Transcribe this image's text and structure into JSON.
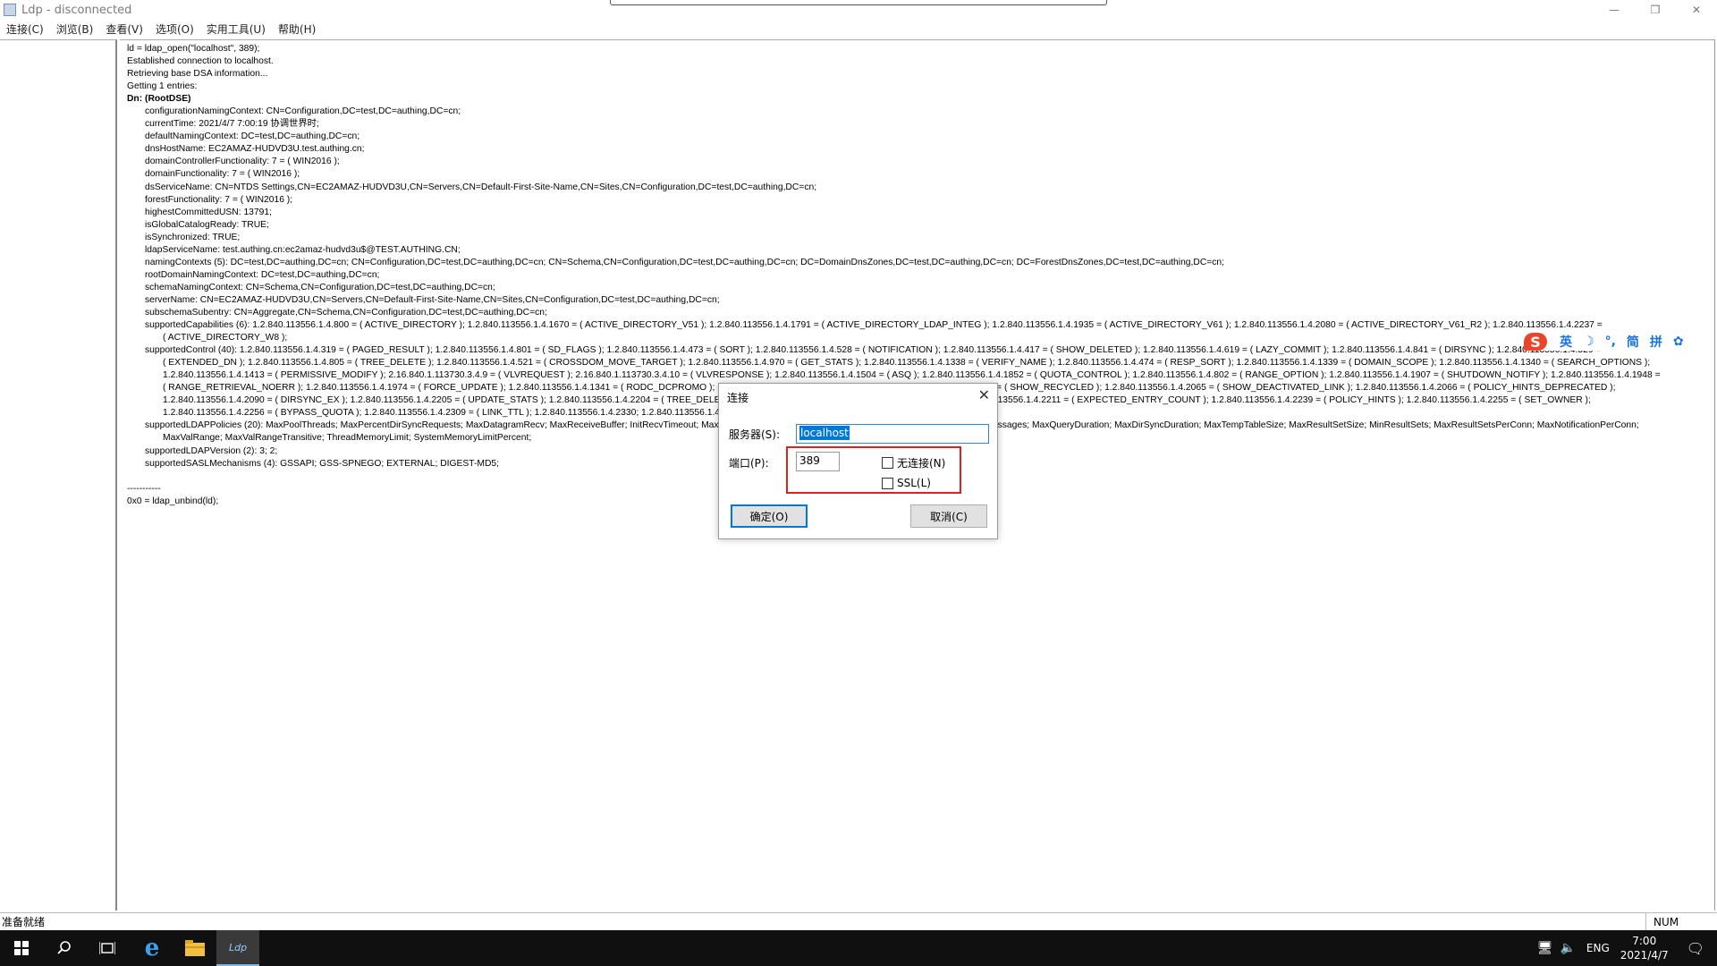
{
  "window": {
    "title": "Ldp - disconnected",
    "controls": {
      "minimize": "—",
      "restore": "❐",
      "close": "✕"
    }
  },
  "menu": [
    "连接(C)",
    "浏览(B)",
    "查看(V)",
    "选项(O)",
    "实用工具(U)",
    "帮助(H)"
  ],
  "log": [
    {
      "indent": 0,
      "bold": false,
      "text": "ld = ldap_open(\"localhost\", 389);"
    },
    {
      "indent": 0,
      "bold": false,
      "text": "Established connection to localhost."
    },
    {
      "indent": 0,
      "bold": false,
      "text": "Retrieving base DSA information..."
    },
    {
      "indent": 0,
      "bold": false,
      "text": "Getting 1 entries:"
    },
    {
      "indent": 0,
      "bold": true,
      "text": "Dn: (RootDSE)"
    },
    {
      "indent": 1,
      "bold": false,
      "text": "configurationNamingContext: CN=Configuration,DC=test,DC=authing,DC=cn;"
    },
    {
      "indent": 1,
      "bold": false,
      "text": "currentTime: 2021/4/7 7:00:19 协调世界时;"
    },
    {
      "indent": 1,
      "bold": false,
      "text": "defaultNamingContext: DC=test,DC=authing,DC=cn;"
    },
    {
      "indent": 1,
      "bold": false,
      "text": "dnsHostName: EC2AMAZ-HUDVD3U.test.authing.cn;"
    },
    {
      "indent": 1,
      "bold": false,
      "text": "domainControllerFunctionality: 7 = ( WIN2016 );"
    },
    {
      "indent": 1,
      "bold": false,
      "text": "domainFunctionality: 7 = ( WIN2016 );"
    },
    {
      "indent": 1,
      "bold": false,
      "text": "dsServiceName: CN=NTDS Settings,CN=EC2AMAZ-HUDVD3U,CN=Servers,CN=Default-First-Site-Name,CN=Sites,CN=Configuration,DC=test,DC=authing,DC=cn;"
    },
    {
      "indent": 1,
      "bold": false,
      "text": "forestFunctionality: 7 = ( WIN2016 );"
    },
    {
      "indent": 1,
      "bold": false,
      "text": "highestCommittedUSN: 13791;"
    },
    {
      "indent": 1,
      "bold": false,
      "text": "isGlobalCatalogReady: TRUE;"
    },
    {
      "indent": 1,
      "bold": false,
      "text": "isSynchronized: TRUE;"
    },
    {
      "indent": 1,
      "bold": false,
      "text": "ldapServiceName: test.authing.cn:ec2amaz-hudvd3u$@TEST.AUTHING.CN;"
    },
    {
      "indent": 1,
      "bold": false,
      "text": "namingContexts (5): DC=test,DC=authing,DC=cn; CN=Configuration,DC=test,DC=authing,DC=cn; CN=Schema,CN=Configuration,DC=test,DC=authing,DC=cn; DC=DomainDnsZones,DC=test,DC=authing,DC=cn; DC=ForestDnsZones,DC=test,DC=authing,DC=cn;"
    },
    {
      "indent": 1,
      "bold": false,
      "text": "rootDomainNamingContext: DC=test,DC=authing,DC=cn;"
    },
    {
      "indent": 1,
      "bold": false,
      "text": "schemaNamingContext: CN=Schema,CN=Configuration,DC=test,DC=authing,DC=cn;"
    },
    {
      "indent": 1,
      "bold": false,
      "text": "serverName: CN=EC2AMAZ-HUDVD3U,CN=Servers,CN=Default-First-Site-Name,CN=Sites,CN=Configuration,DC=test,DC=authing,DC=cn;"
    },
    {
      "indent": 1,
      "bold": false,
      "text": "subschemaSubentry: CN=Aggregate,CN=Schema,CN=Configuration,DC=test,DC=authing,DC=cn;"
    },
    {
      "indent": 1,
      "bold": false,
      "text": "supportedCapabilities (6): 1.2.840.113556.1.4.800 = ( ACTIVE_DIRECTORY ); 1.2.840.113556.1.4.1670 = ( ACTIVE_DIRECTORY_V51 ); 1.2.840.113556.1.4.1791 = ( ACTIVE_DIRECTORY_LDAP_INTEG ); 1.2.840.113556.1.4.1935 = ( ACTIVE_DIRECTORY_V61 ); 1.2.840.113556.1.4.2080 = ( ACTIVE_DIRECTORY_V61_R2 ); 1.2.840.113556.1.4.2237 ="
    },
    {
      "indent": 2,
      "bold": false,
      "text": "( ACTIVE_DIRECTORY_W8 );"
    },
    {
      "indent": 1,
      "bold": false,
      "text": "supportedControl (40): 1.2.840.113556.1.4.319 = ( PAGED_RESULT ); 1.2.840.113556.1.4.801 = ( SD_FLAGS ); 1.2.840.113556.1.4.473 = ( SORT ); 1.2.840.113556.1.4.528 = ( NOTIFICATION ); 1.2.840.113556.1.4.417 = ( SHOW_DELETED ); 1.2.840.113556.1.4.619 = ( LAZY_COMMIT ); 1.2.840.113556.1.4.841 = ( DIRSYNC ); 1.2.840.113556.1.4.529 ="
    },
    {
      "indent": 2,
      "bold": false,
      "text": "( EXTENDED_DN ); 1.2.840.113556.1.4.805 = ( TREE_DELETE ); 1.2.840.113556.1.4.521 = ( CROSSDOM_MOVE_TARGET ); 1.2.840.113556.1.4.970 = ( GET_STATS ); 1.2.840.113556.1.4.1338 = ( VERIFY_NAME ); 1.2.840.113556.1.4.474 = ( RESP_SORT ); 1.2.840.113556.1.4.1339 = ( DOMAIN_SCOPE ); 1.2.840.113556.1.4.1340 = ( SEARCH_OPTIONS );"
    },
    {
      "indent": 2,
      "bold": false,
      "text": "1.2.840.113556.1.4.1413 = ( PERMISSIVE_MODIFY ); 2.16.840.1.113730.3.4.9 = ( VLVREQUEST ); 2.16.840.1.113730.3.4.10 = ( VLVRESPONSE ); 1.2.840.113556.1.4.1504 = ( ASQ ); 1.2.840.113556.1.4.1852 = ( QUOTA_CONTROL ); 1.2.840.113556.1.4.802 = ( RANGE_OPTION ); 1.2.840.113556.1.4.1907 = ( SHUTDOWN_NOTIFY ); 1.2.840.113556.1.4.1948 ="
    },
    {
      "indent": 2,
      "bold": false,
      "text": "( RANGE_RETRIEVAL_NOERR ); 1.2.840.113556.1.4.1974 = ( FORCE_UPDATE ); 1.2.840.113556.1.4.1341 = ( RODC_DCPROMO ); 1.2.840.113556.1.4.2026 = ( INPUT_DN ); 1.2.840.113556.1.4.2064 = ( SHOW_RECYCLED ); 1.2.840.113556.1.4.2065 = ( SHOW_DEACTIVATED_LINK ); 1.2.840.113556.1.4.2066 = ( POLICY_HINTS_DEPRECATED );"
    },
    {
      "indent": 2,
      "bold": false,
      "text": "1.2.840.113556.1.4.2090 = ( DIRSYNC_EX ); 1.2.840.113556.1.4.2205 = ( UPDATE_STATS ); 1.2.840.113556.1.4.2204 = ( TREE_DELETE_EX ); 1.2.840.113556.1.4.2206 = ( SEARCH_HINTS ); 1.2.840.113556.1.4.2211 = ( EXPECTED_ENTRY_COUNT ); 1.2.840.113556.1.4.2239 = ( POLICY_HINTS ); 1.2.840.113556.1.4.2255 = ( SET_OWNER );"
    },
    {
      "indent": 2,
      "bold": false,
      "text": "1.2.840.113556.1.4.2256 = ( BYPASS_QUOTA ); 1.2.840.113556.1.4.2309 = ( LINK_TTL ); 1.2.840.113556.1.4.2330; 1.2.840.113556.1.4.2354;"
    },
    {
      "indent": 1,
      "bold": false,
      "text": "supportedLDAPPolicies (20): MaxPoolThreads; MaxPercentDirSyncRequests; MaxDatagramRecv; MaxReceiveBuffer; InitRecvTimeout; MaxConnections; MaxConnIdleTime; MaxPageSize; MaxBatchReturnMessages; MaxQueryDuration; MaxDirSyncDuration; MaxTempTableSize; MaxResultSetSize; MinResultSets; MaxResultSetsPerConn; MaxNotificationPerConn;"
    },
    {
      "indent": 2,
      "bold": false,
      "text": "MaxValRange; MaxValRangeTransitive; ThreadMemoryLimit; SystemMemoryLimitPercent;"
    },
    {
      "indent": 1,
      "bold": false,
      "text": "supportedLDAPVersion (2): 3; 2;"
    },
    {
      "indent": 1,
      "bold": false,
      "text": "supportedSASLMechanisms (4): GSSAPI; GSS-SPNEGO; EXTERNAL; DIGEST-MD5;"
    },
    {
      "indent": 0,
      "bold": false,
      "text": ""
    },
    {
      "indent": 0,
      "bold": false,
      "text": "-----------"
    },
    {
      "indent": 0,
      "bold": false,
      "text": "0x0 = ldap_unbind(ld);"
    }
  ],
  "ime": {
    "logo": "S",
    "items": [
      "英",
      "☽",
      "°,",
      "简",
      "拼",
      "✿"
    ]
  },
  "dialog": {
    "title": "连接",
    "close": "✕",
    "server_label": "服务器(S):",
    "server_value": "localhost",
    "port_label": "端口(P):",
    "port_value": "389",
    "connectionless_label": "无连接(N)",
    "ssl_label": "SSL(L)",
    "ok_label": "确定(O)",
    "cancel_label": "取消(C)"
  },
  "status": {
    "text": "准备就绪",
    "num": "NUM"
  },
  "taskbar": {
    "apps": [
      "windows-start",
      "search",
      "task-view",
      "internet-explorer",
      "file-explorer",
      "ldp"
    ],
    "ldp_label": "Ldp",
    "lang": "ENG",
    "time": "7:00",
    "date": "2021/4/7"
  },
  "colors": {
    "accent": "#0078d7",
    "highlight_box": "#e02020",
    "taskbar": "#101010"
  }
}
